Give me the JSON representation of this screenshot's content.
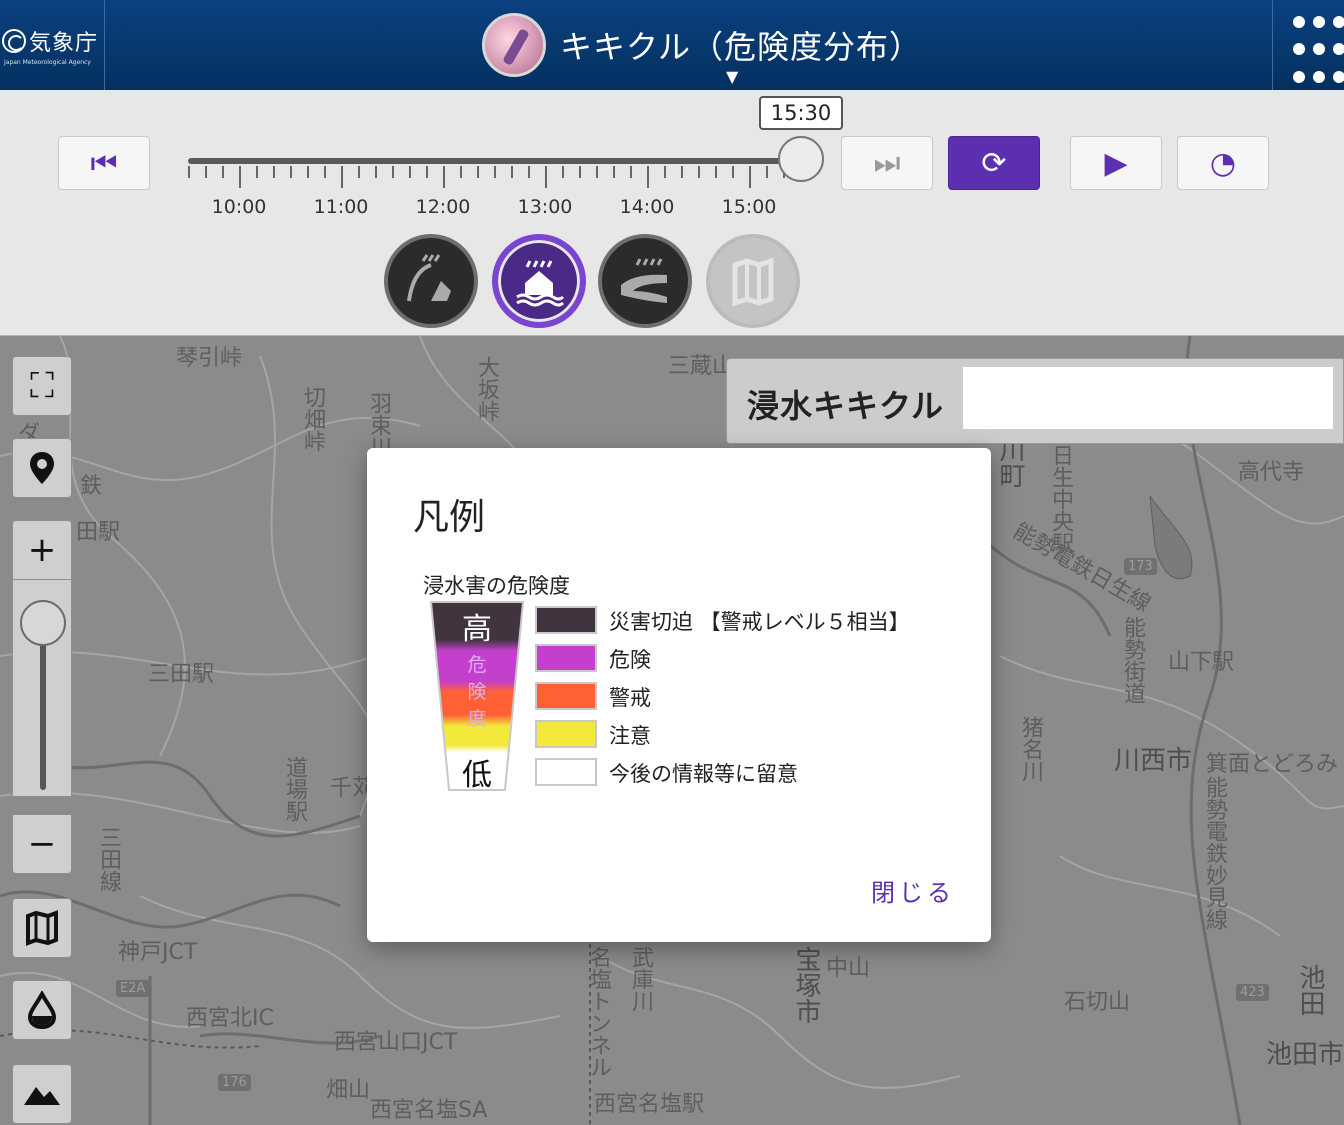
{
  "header": {
    "logo_text": "気象庁",
    "logo_sub": "Japan Meteorological Agency",
    "app_title": "キキクル（危険度分布）"
  },
  "timeline": {
    "current_time": "15:30",
    "tick_labels": [
      "10:00",
      "11:00",
      "12:00",
      "13:00",
      "14:00",
      "15:00"
    ],
    "buttons": {
      "first": "⏮",
      "last": "⏭",
      "latest": "⟳",
      "play": "▶",
      "speed": "◔"
    }
  },
  "modes": [
    {
      "name": "landslide",
      "icon": "landslide-icon"
    },
    {
      "name": "inundation",
      "icon": "inundation-icon",
      "active": true
    },
    {
      "name": "flood",
      "icon": "flood-icon"
    },
    {
      "name": "map",
      "icon": "map-icon",
      "disabled": true
    }
  ],
  "map_panel": {
    "title": "浸水キキクル",
    "box_value": ""
  },
  "side_tools": {
    "fullscreen": "⛶",
    "locate": "⚲",
    "zoom_in": "+",
    "zoom_out": "−",
    "basemap": "🗺",
    "water": "💧",
    "terrain": "⛰"
  },
  "map_labels": {
    "l1": "琴引峠",
    "l2": "切畑峠",
    "l3": "羽束川",
    "l4": "大坂峠",
    "l5": "三田駅",
    "l6": "道場駅",
    "l7": "千苅",
    "l8": "三田線",
    "l9": "神戸JCT",
    "l10": "西宮北IC",
    "l11": "西宮山口JCT",
    "l12": "西宮名塩SA",
    "l13": "畑山",
    "l14": "名塩トンネル",
    "l15": "武庫川",
    "l16": "宝塚市",
    "l17": "中山",
    "l18": "西宮名塩駅",
    "l19": "川西市",
    "l20": "能勢電鉄妙見線",
    "l21": "池田市",
    "l22": "石切山",
    "l23": "高代寺",
    "l24": "山下駅",
    "l25": "能勢街道",
    "l26": "猪名川",
    "l27": "日生中央駅",
    "l28": "三蔵山",
    "l29": "箕面とどろみ",
    "l30": "池田",
    "l31": "川町",
    "l32": "ダ",
    "l33": "田駅",
    "l34": "鉄",
    "l35": "能勢電鉄日生線",
    "shield1": "E2A",
    "shield2": "176",
    "shield3": "173",
    "shield4": "423"
  },
  "legend": {
    "title": "凡例",
    "subtitle": "浸水害の危険度",
    "scale_high": "高",
    "scale_low": "低",
    "scale_mid": [
      "危",
      "険",
      "度"
    ],
    "levels": [
      {
        "label": "災害切迫 【警戒レベル５相当】",
        "color": "#41343f"
      },
      {
        "label": "危険",
        "color": "#c33fcc"
      },
      {
        "label": "警戒",
        "color": "#ff6135"
      },
      {
        "label": "注意",
        "color": "#f2e93a"
      },
      {
        "label": "今後の情報等に留意",
        "color": "#ffffff"
      }
    ],
    "close": "閉じる"
  },
  "colors": {
    "header_bg": "#0b4180",
    "accent": "#5b2fb0"
  }
}
